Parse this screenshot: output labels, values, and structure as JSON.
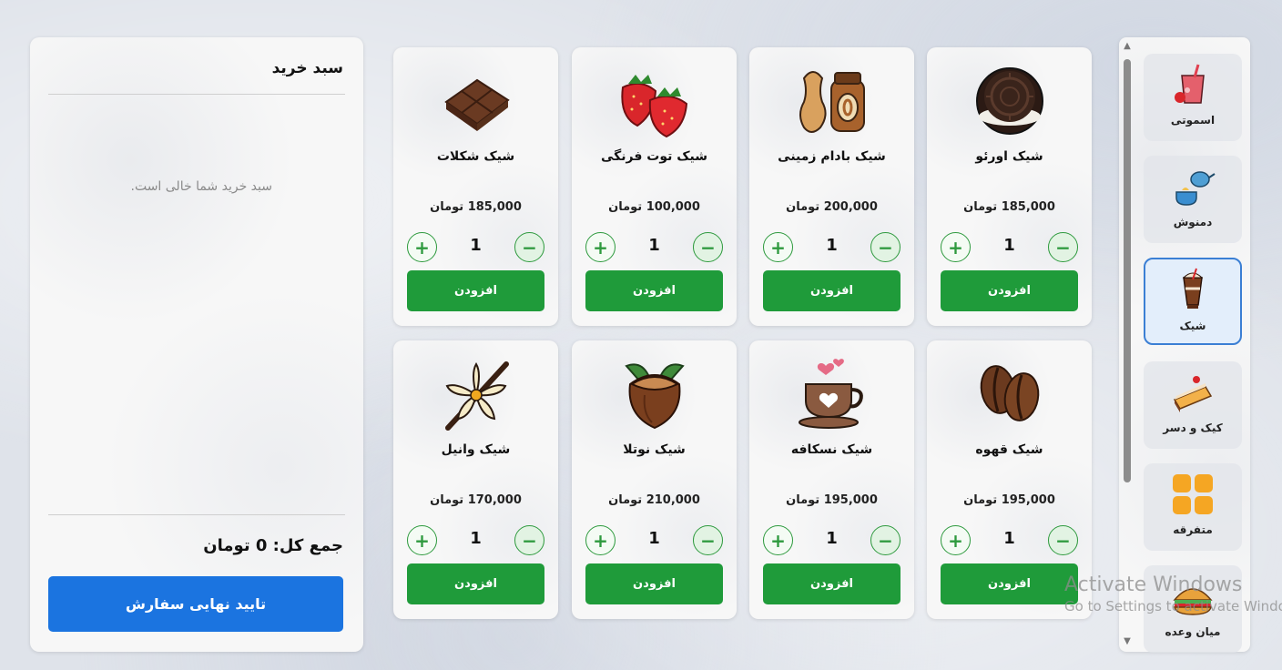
{
  "cart": {
    "title": "سبد خرید",
    "empty_message": "سبد خرید شما خالی است.",
    "total_label": "جمع کل: 0 تومان",
    "confirm_label": "تایید نهایی سفارش"
  },
  "products": [
    {
      "name": "شیک اورئو",
      "price": "185,000 تومان",
      "qty": "1",
      "add_label": "افزودن",
      "icon": "oreo-cookie-icon"
    },
    {
      "name": "شیک بادام زمینی",
      "price": "200,000 تومان",
      "qty": "1",
      "add_label": "افزودن",
      "icon": "peanut-butter-icon"
    },
    {
      "name": "شیک توت فرنگی",
      "price": "100,000 تومان",
      "qty": "1",
      "add_label": "افزودن",
      "icon": "strawberry-icon"
    },
    {
      "name": "شیک شکلات",
      "price": "185,000 تومان",
      "qty": "1",
      "add_label": "افزودن",
      "icon": "chocolate-bar-icon"
    },
    {
      "name": "شیک قهوه",
      "price": "195,000 تومان",
      "qty": "1",
      "add_label": "افزودن",
      "icon": "coffee-beans-icon"
    },
    {
      "name": "شیک نسکافه",
      "price": "195,000 تومان",
      "qty": "1",
      "add_label": "افزودن",
      "icon": "coffee-cup-hearts-icon"
    },
    {
      "name": "شیک نوتلا",
      "price": "210,000 تومان",
      "qty": "1",
      "add_label": "افزودن",
      "icon": "hazelnut-icon"
    },
    {
      "name": "شیک وانیل",
      "price": "170,000 تومان",
      "qty": "1",
      "add_label": "افزودن",
      "icon": "vanilla-flower-icon"
    }
  ],
  "categories": [
    {
      "label": "اسموتی",
      "icon": "smoothie-icon",
      "active": false
    },
    {
      "label": "دمنوش",
      "icon": "teapot-icon",
      "active": false
    },
    {
      "label": "شیک",
      "icon": "milkshake-icon",
      "active": true
    },
    {
      "label": "کیک و دسر",
      "icon": "cake-slice-icon",
      "active": false
    },
    {
      "label": "متفرقه",
      "icon": "grid-squares-icon",
      "active": false
    },
    {
      "label": "میان وعده",
      "icon": "sandwich-icon",
      "active": false
    }
  ],
  "watermark": {
    "title": "Activate Windows",
    "subtitle": "Go to Settings to activate Windows."
  },
  "colors": {
    "add_button": "#1f9b3a",
    "confirm_button": "#1b74e0",
    "active_category_border": "#3b7fd4"
  }
}
